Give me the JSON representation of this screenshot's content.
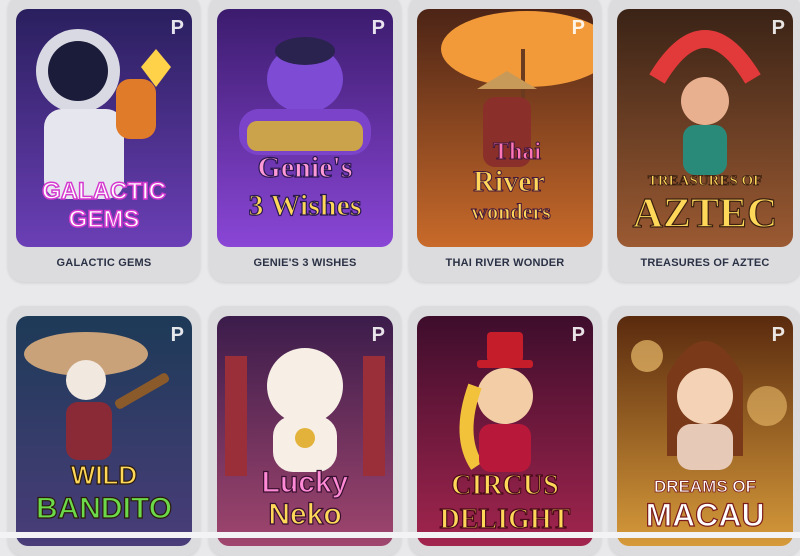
{
  "provider_badge": "P",
  "games": [
    {
      "title": "GALACTIC GEMS",
      "logo": [
        "GALACTIC",
        "GEMS"
      ],
      "colors": [
        "#2a1f5e",
        "#6b3fb6"
      ],
      "icon": "astronaut-art"
    },
    {
      "title": "GENIE'S 3 WISHES",
      "logo": [
        "Genie's",
        "3 Wishes"
      ],
      "colors": [
        "#3c1c6e",
        "#8a46d6"
      ],
      "icon": "genie-art"
    },
    {
      "title": "THAI RIVER WONDER",
      "logo": [
        "Thai",
        "River",
        "wonders"
      ],
      "colors": [
        "#4c2416",
        "#c86a2a"
      ],
      "icon": "boatman-art"
    },
    {
      "title": "TREASURES OF AZTEC",
      "logo": [
        "TREASURES OF",
        "AZTEC"
      ],
      "colors": [
        "#3a2316",
        "#9b5a32"
      ],
      "icon": "aztec-queen-art"
    },
    {
      "title": "WILD BANDITO",
      "logo": [
        "WILD",
        "BANDITO"
      ],
      "colors": [
        "#1d3a57",
        "#4a3d7a"
      ],
      "icon": "mariachi-skeleton-art"
    },
    {
      "title": "LUCKY NEKO",
      "logo": [
        "Lucky",
        "Neko"
      ],
      "colors": [
        "#3b1c4b",
        "#a0466e"
      ],
      "icon": "lucky-cat-art"
    },
    {
      "title": "CIRCUS DELIGHT",
      "logo": [
        "CIRCUS",
        "DELIGHT"
      ],
      "colors": [
        "#3e0d2c",
        "#a2254e"
      ],
      "icon": "ringmaster-art"
    },
    {
      "title": "DREAMS OF MACAU",
      "logo": [
        "DREAMS OF",
        "MACAU"
      ],
      "colors": [
        "#5a2a0e",
        "#d69a3a"
      ],
      "icon": "macau-lady-art"
    }
  ]
}
